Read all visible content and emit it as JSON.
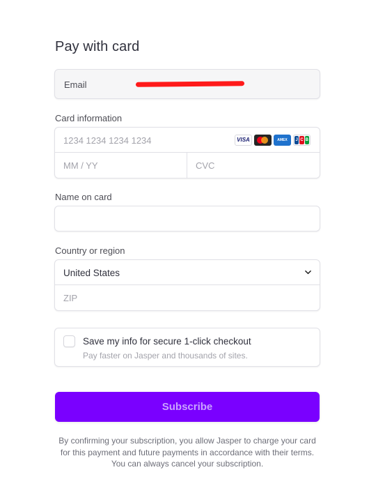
{
  "form": {
    "title": "Pay with card",
    "email": {
      "label": "Email",
      "value": ""
    },
    "card_information": {
      "label": "Card information",
      "number_placeholder": "1234 1234 1234 1234",
      "expiry_placeholder": "MM / YY",
      "cvc_placeholder": "CVC",
      "brands": [
        "VISA",
        "Mastercard",
        "AMEX",
        "JCB"
      ]
    },
    "name_on_card": {
      "label": "Name on card",
      "value": ""
    },
    "country_region": {
      "label": "Country or region",
      "selected": "United States",
      "zip_placeholder": "ZIP"
    },
    "save_info": {
      "title": "Save my info for secure 1-click checkout",
      "subtitle": "Pay faster on Jasper and thousands of sites.",
      "checked": false
    },
    "subscribe_label": "Subscribe",
    "terms": "By confirming your subscription, you allow Jasper to charge your card for this payment and future payments in accordance with their terms. You can always cancel your subscription."
  },
  "colors": {
    "accent": "#7a00ff",
    "redaction": "#ff1a1a"
  }
}
